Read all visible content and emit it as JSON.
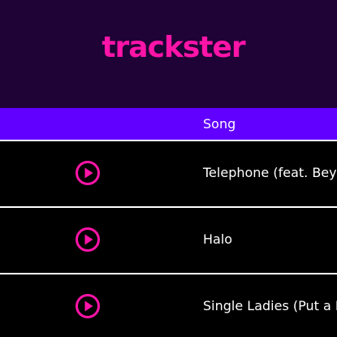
{
  "app": {
    "logo": "trackster"
  },
  "table": {
    "song_header": "Song",
    "rows": [
      {
        "title": "Telephone (feat. Beyoncé)",
        "play_icon": "play-circle-icon"
      },
      {
        "title": "Halo",
        "play_icon": "play-circle-icon"
      },
      {
        "title": "Single Ladies (Put a Ring on It)",
        "play_icon": "play-circle-icon"
      }
    ]
  },
  "colors": {
    "header_bg": "#1f0336",
    "logo": "#ff14a8",
    "table_header_bg": "#6200ff",
    "row_bg": "#000000",
    "row_divider": "#ffffff",
    "play_icon": "#ff14a8",
    "text": "#ffffff"
  }
}
